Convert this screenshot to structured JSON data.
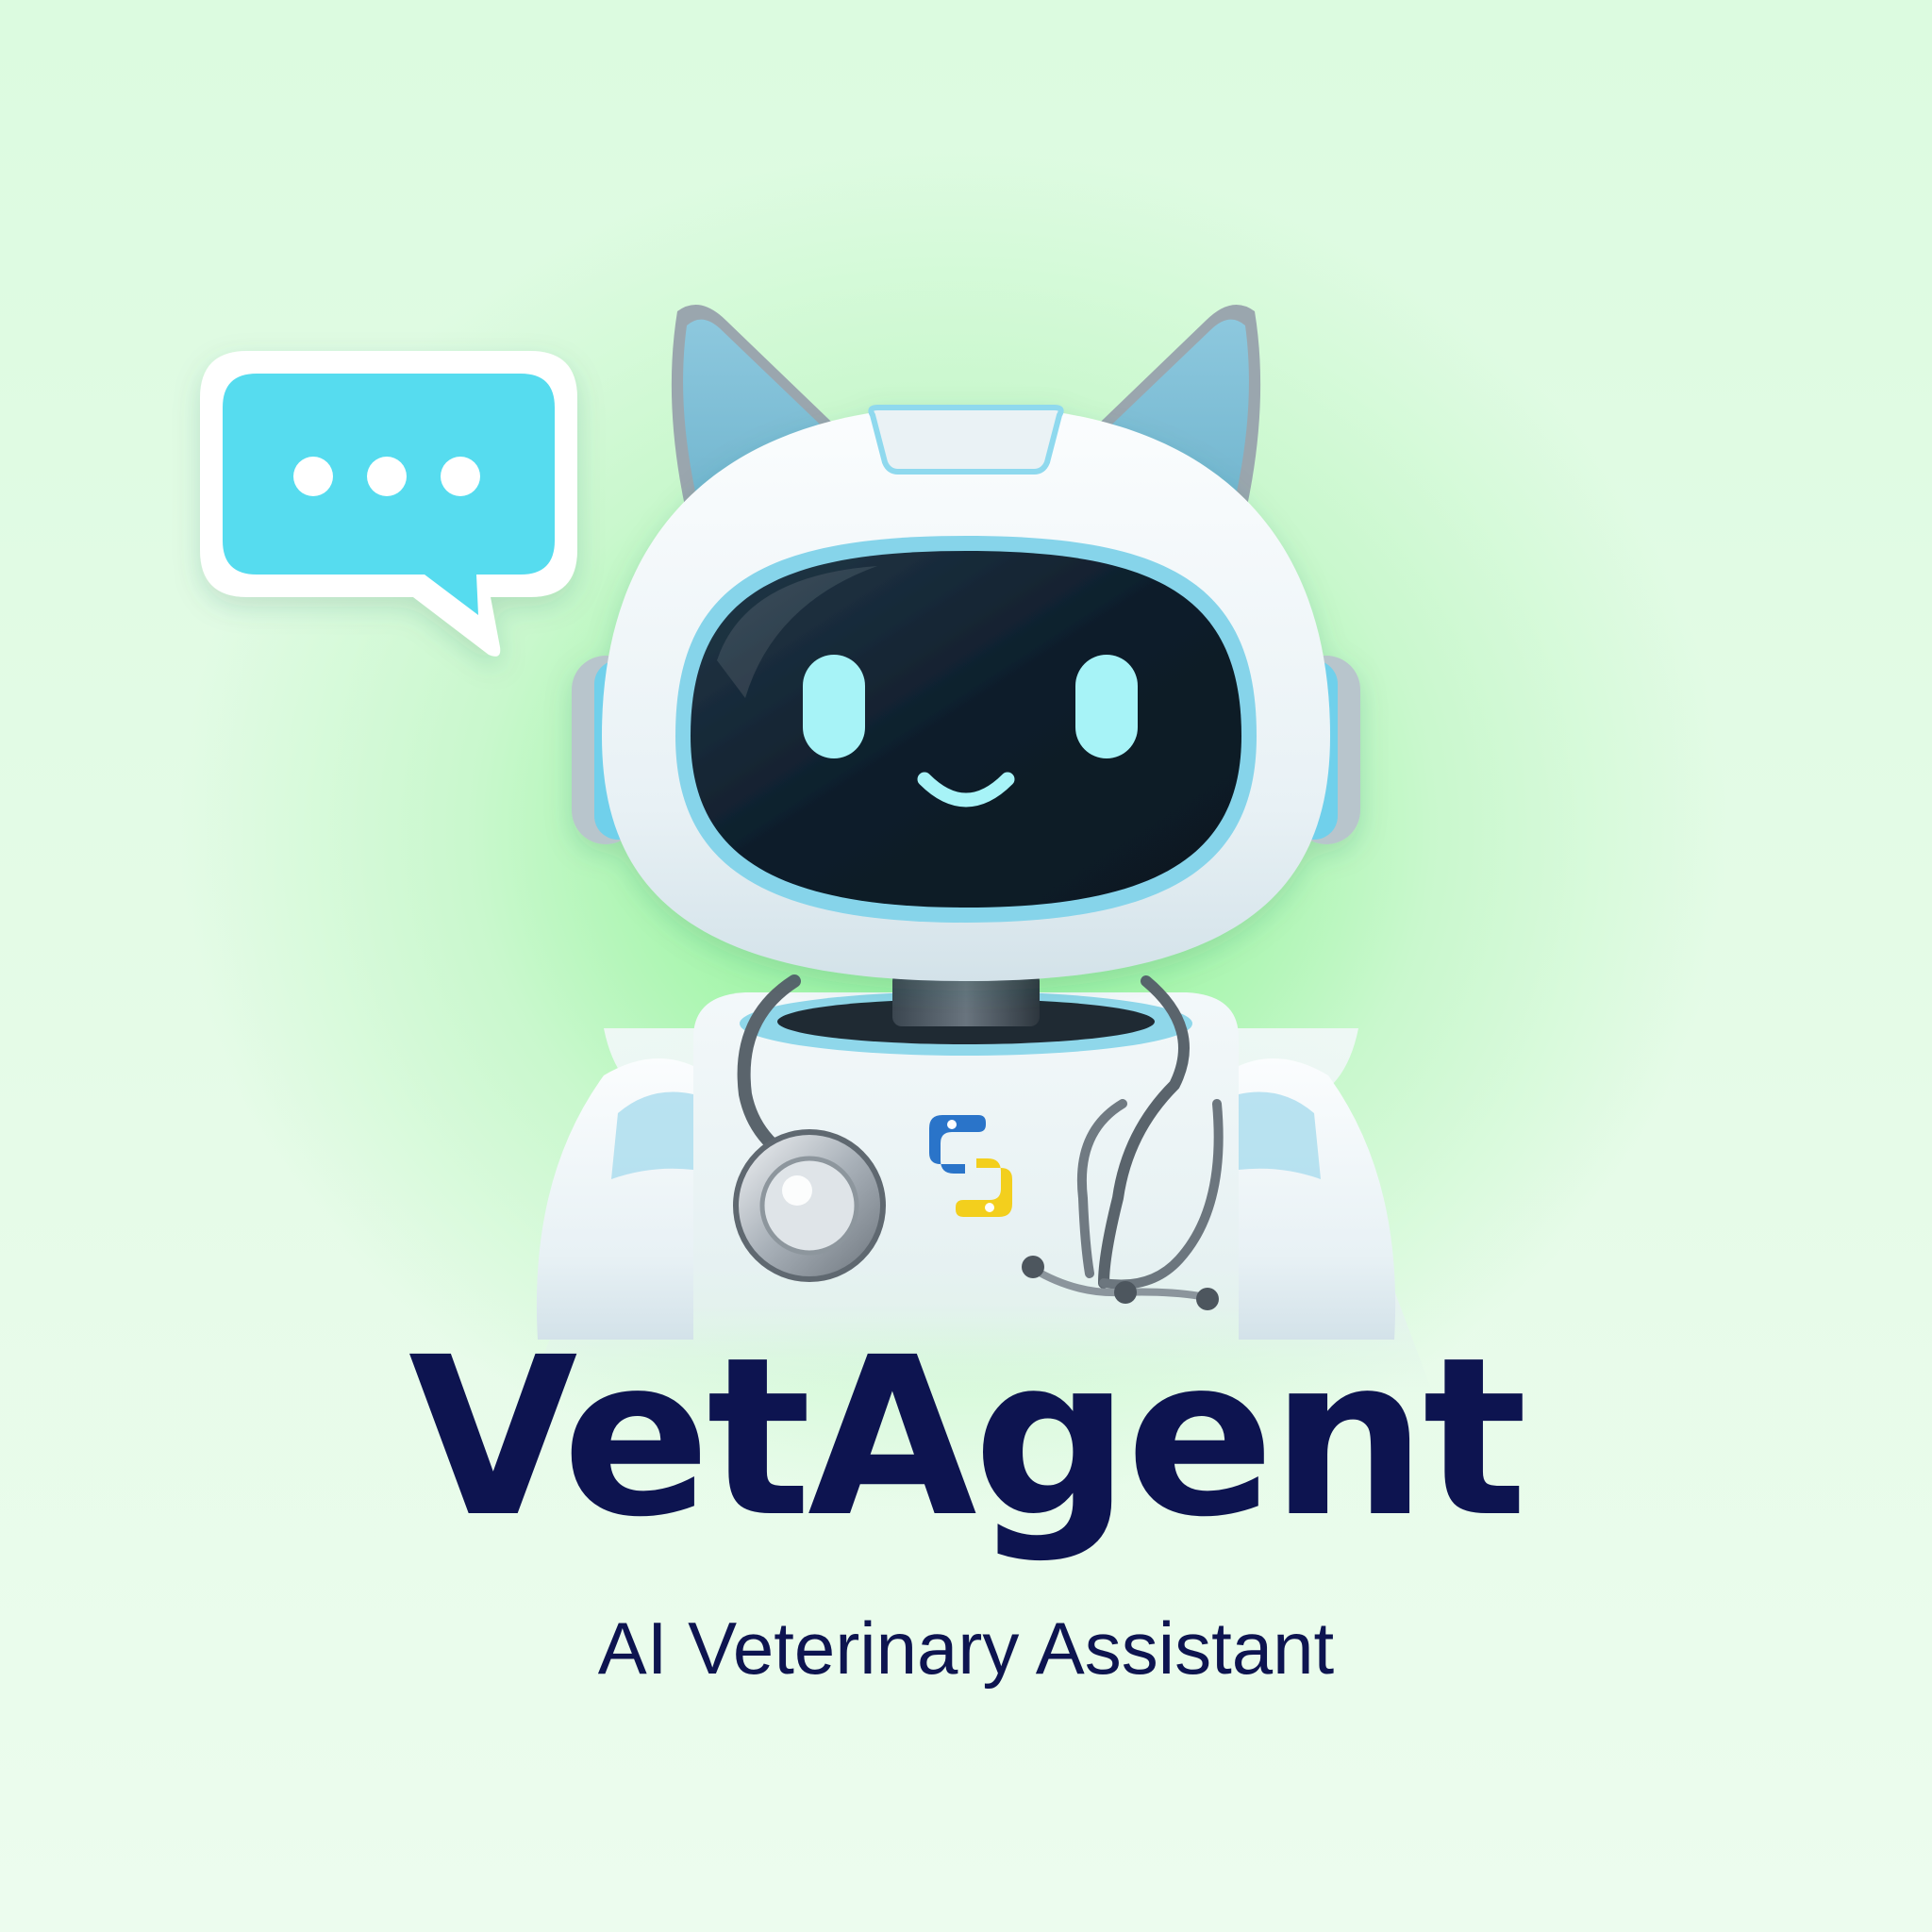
{
  "brand": {
    "name": "VetAgent",
    "tagline": "AI Veterinary Assistant"
  },
  "colors": {
    "text": "#0d1450",
    "bubble": "#57dcef",
    "visor": "#0f1f2c",
    "eyes": "#a7f3f7",
    "accent": "#7fd6ee",
    "body": "#eef5f7",
    "background_glow": "#8ff59b"
  },
  "icons": {
    "chat_bubble": "chat-bubble-icon",
    "stethoscope": "stethoscope-icon",
    "python_logo": "python-logo-icon"
  }
}
